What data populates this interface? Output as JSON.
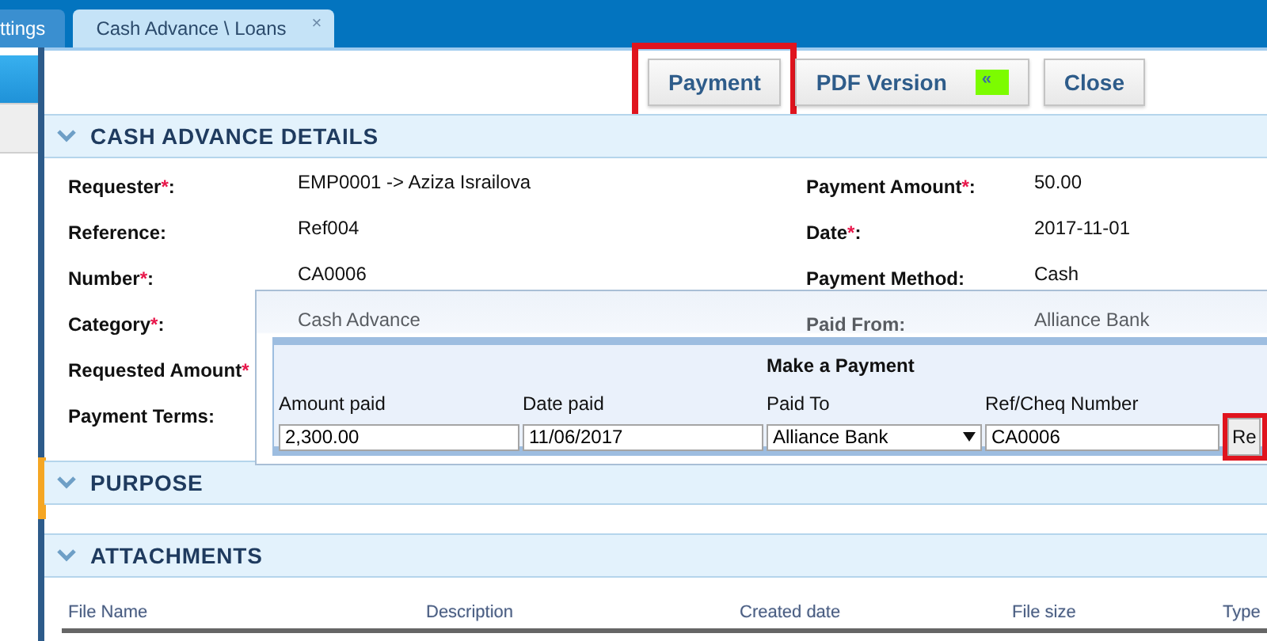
{
  "tabs": [
    {
      "label": "ttings",
      "selected": false
    },
    {
      "label": "Cash Advance \\ Loans",
      "selected": true,
      "close": "×"
    }
  ],
  "sidebar": {
    "items": [
      {
        "selected": true
      },
      {
        "selected": false
      }
    ],
    "handle": {
      "selected": true
    }
  },
  "toolbar": {
    "buttons": [
      {
        "label": "Payment",
        "highlighted": true
      },
      {
        "label": "PDF Version",
        "badge": "«",
        "highlighted": false
      },
      {
        "label": "Close",
        "highlighted": false
      }
    ]
  },
  "details": {
    "title": "CASH ADVANCE DETAILS",
    "expanded": true,
    "rows": [
      {
        "left": {
          "label": "Requester",
          "required_mark": "*",
          "suffix": ":",
          "value": "EMP0001 -> Aziza Israilova"
        },
        "right": {
          "label": "Payment Amount",
          "required_mark": "*",
          "suffix": ":",
          "value": "50.00"
        }
      },
      {
        "left": {
          "label": "Reference:",
          "value": "Ref004"
        },
        "right": {
          "label": "Date",
          "required_mark": "*",
          "suffix": ":",
          "value": "2017-11-01"
        }
      },
      {
        "left": {
          "label": "Number",
          "required_mark": "*",
          "suffix": ":",
          "value": "CA0006"
        },
        "right": {
          "label": "Payment Method:",
          "value": "Cash"
        }
      },
      {
        "left": {
          "label": "Category",
          "required_mark": "*",
          "suffix": ":",
          "value": "Cash Advance"
        },
        "right": {
          "label": "Paid From:",
          "value": "Alliance Bank"
        }
      },
      {
        "left": {
          "label": "Requested Amount",
          "required_mark": "*"
        }
      },
      {
        "left": {
          "label": "Payment Terms:"
        }
      }
    ]
  },
  "dialog": {
    "title": "Make a Payment",
    "fields": [
      {
        "label": "Amount paid",
        "kind": "text",
        "value": "2,300.00"
      },
      {
        "label": "Date paid",
        "kind": "text",
        "value": "11/06/2017"
      },
      {
        "label": "Paid To",
        "kind": "select",
        "value": "Alliance Bank"
      },
      {
        "label": "Ref/Cheq Number",
        "kind": "text",
        "value": "CA0006"
      }
    ],
    "button": {
      "label": "Re",
      "highlighted": true
    }
  },
  "purpose": {
    "title": "PURPOSE",
    "expanded": true
  },
  "attachments": {
    "title": "ATTACHMENTS",
    "expanded": true,
    "columns": [
      "File Name",
      "Description",
      "Created date",
      "File size",
      "Type"
    ]
  }
}
